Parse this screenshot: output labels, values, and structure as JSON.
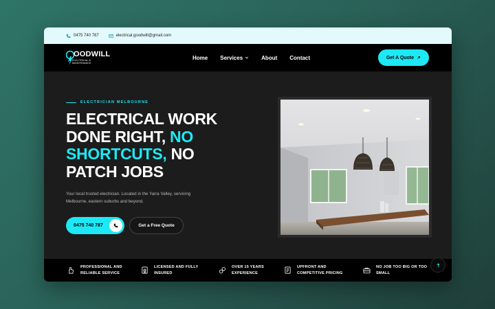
{
  "topbar": {
    "phone": "0475 740 787",
    "email": "electrical.goodwill@gmail.com"
  },
  "logo": {
    "word": "OODWILL",
    "lines": [
      "ELECTRICAL &",
      "MAINTENANCE"
    ]
  },
  "nav": {
    "items": [
      {
        "label": "Home"
      },
      {
        "label": "Services"
      },
      {
        "label": "About"
      },
      {
        "label": "Contact"
      }
    ],
    "cta": "Get A Quote"
  },
  "hero": {
    "eyebrow": "ELECTRICIAN MELBOURNE",
    "headline": {
      "l1": "ELECTRICAL WORK",
      "l2a": "DONE RIGHT, ",
      "l2b": "NO",
      "l3a": "SHORTCUTS,",
      "l3b": " NO",
      "l4": "PATCH JOBS"
    },
    "description": "Your local trusted electrician. Located in the Yarra Valley, servicing Melbourne, eastern suburbs and beyond.",
    "phone_button": "0475 740 787",
    "free_quote_button": "Get a Free Quote"
  },
  "features": [
    {
      "icon": "hand-icon",
      "lines": [
        "PROFESSIONAL AND",
        "RELIABLE SERVICE"
      ]
    },
    {
      "icon": "license-icon",
      "lines": [
        "LICENSED AND FULLY",
        "INSURED"
      ]
    },
    {
      "icon": "experience-icon",
      "lines": [
        "OVER 15 YEARS",
        "EXPERIENCE"
      ]
    },
    {
      "icon": "pricing-icon",
      "lines": [
        "UPFRONT AND",
        "COMPETITIVE PRICING"
      ]
    },
    {
      "icon": "toolbox-icon",
      "lines": [
        "NO JOB TOO BIG OR TOO",
        "SMALL"
      ]
    }
  ],
  "colors": {
    "accent": "#1de9f6",
    "topbar_bg": "#e3fafc",
    "nav_bg": "#000000",
    "hero_bg": "#1c1c1c"
  }
}
